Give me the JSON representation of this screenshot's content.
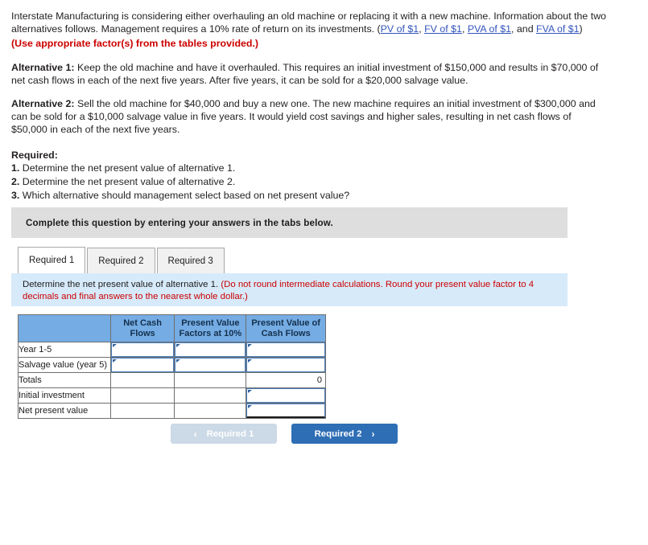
{
  "stem": {
    "intro_part1": "Interstate Manufacturing is considering either overhauling an old machine or replacing it with a new machine. Information about the two alternatives follows. Management requires a 10% rate of return on its investments. (",
    "links": [
      "PV of $1",
      "FV of $1",
      "PVA of $1",
      "FVA of $1"
    ],
    "link_sep1": ", ",
    "link_sep2": ", ",
    "link_sep3": ", and ",
    "intro_close": ")",
    "instruction_red": "(Use appropriate factor(s) from the tables provided.)",
    "alt1_label": "Alternative 1:",
    "alt1_text": " Keep the old machine and have it overhauled. This requires an initial investment of $150,000 and results in $70,000 of net cash flows in each of the next five years. After five years, it can be sold for a $20,000 salvage value.",
    "alt2_label": "Alternative 2:",
    "alt2_text": " Sell the old machine for $40,000 and buy a new one. The new machine requires an initial investment of $300,000 and can be sold for a $10,000 salvage value in five years. It would yield cost savings and higher sales, resulting in net cash flows of $50,000 in each of the next five years."
  },
  "required": {
    "heading": "Required:",
    "items": [
      {
        "num": "1.",
        "text": " Determine the net present value of alternative 1."
      },
      {
        "num": "2.",
        "text": " Determine the net present value of alternative 2."
      },
      {
        "num": "3.",
        "text": " Which alternative should management select based on net present value?"
      }
    ]
  },
  "banner": {
    "text": "Complete this question by entering your answers in the tabs below."
  },
  "tabs": [
    {
      "label": "Required 1",
      "active": true
    },
    {
      "label": "Required 2",
      "active": false
    },
    {
      "label": "Required 3",
      "active": false
    }
  ],
  "instruction_box": {
    "black_text": "Determine the net present value of alternative 1. ",
    "red_text": "(Do not round intermediate calculations. Round your present value factor to 4 decimals and final answers to the nearest whole dollar.)"
  },
  "table": {
    "headers": [
      "",
      "Net Cash Flows",
      "Present Value Factors at 10%",
      "Present Value of Cash Flows"
    ],
    "rows": [
      {
        "label": "Year 1-5",
        "ncf": "",
        "pvf": "",
        "pvcf": ""
      },
      {
        "label": "Salvage value (year 5)",
        "ncf": "",
        "pvf": "",
        "pvcf": ""
      },
      {
        "label": "Totals",
        "ncf": "",
        "pvf": "",
        "pvcf": "0"
      },
      {
        "label": "Initial investment",
        "ncf": "",
        "pvf": "",
        "pvcf": ""
      },
      {
        "label": "Net present value",
        "ncf": "",
        "pvf": "",
        "pvcf": ""
      }
    ]
  },
  "nav": {
    "prev_label": "Required 1",
    "next_label": "Required 2",
    "prev_chevron": "‹",
    "next_chevron": "›"
  },
  "colors": {
    "accent_blue": "#2e6eb5",
    "table_header_blue": "#75ace4",
    "info_box_blue": "#d7eafa",
    "banner_gray": "#dedede",
    "red": "#cc0000",
    "link_blue": "#3355bb"
  }
}
